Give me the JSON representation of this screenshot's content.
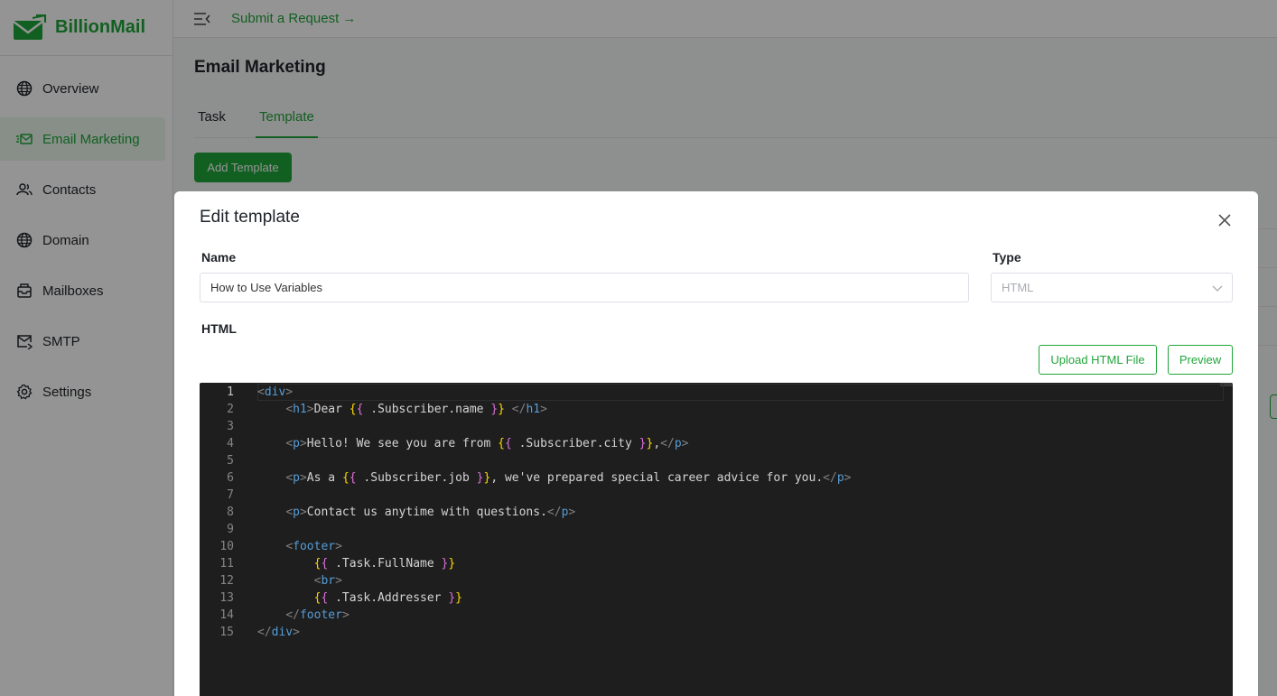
{
  "app": {
    "name": "BillionMail"
  },
  "colors": {
    "accent": "#20a53a",
    "editor_bg": "#1e1e1e"
  },
  "sidebar": {
    "items": [
      {
        "label": "Overview",
        "icon": "globe-icon"
      },
      {
        "label": "Email Marketing",
        "icon": "mail-send-icon",
        "active": true
      },
      {
        "label": "Contacts",
        "icon": "users-icon"
      },
      {
        "label": "Domain",
        "icon": "globe-icon"
      },
      {
        "label": "Mailboxes",
        "icon": "inbox-icon"
      },
      {
        "label": "SMTP",
        "icon": "mail-arrow-icon"
      },
      {
        "label": "Settings",
        "icon": "gear-icon"
      }
    ]
  },
  "topbar": {
    "submit_label": "Submit a Request",
    "menu_icon": "menu-collapse-icon"
  },
  "page": {
    "title": "Email Marketing",
    "tabs": [
      {
        "label": "Task"
      },
      {
        "label": "Template",
        "active": true
      }
    ],
    "add_button": "Add Template"
  },
  "modal": {
    "title": "Edit template",
    "name_label": "Name",
    "name_value": "How to Use Variables",
    "type_label": "Type",
    "type_value": "HTML",
    "html_label": "HTML",
    "upload_button": "Upload HTML File",
    "preview_button": "Preview",
    "editor": {
      "lines": [
        "<div>",
        "    <h1>Dear {{ .Subscriber.name }} </h1>",
        "",
        "    <p>Hello! We see you are from {{ .Subscriber.city }},</p>",
        "",
        "    <p>As a {{ .Subscriber.job }}, we've prepared special career advice for you.</p>",
        "",
        "    <p>Contact us anytime with questions.</p>",
        "",
        "    <footer>",
        "        {{ .Task.FullName }}",
        "        <br>",
        "        {{ .Task.Addresser }}",
        "    </footer>",
        "</div>"
      ],
      "current_line": 1
    }
  }
}
